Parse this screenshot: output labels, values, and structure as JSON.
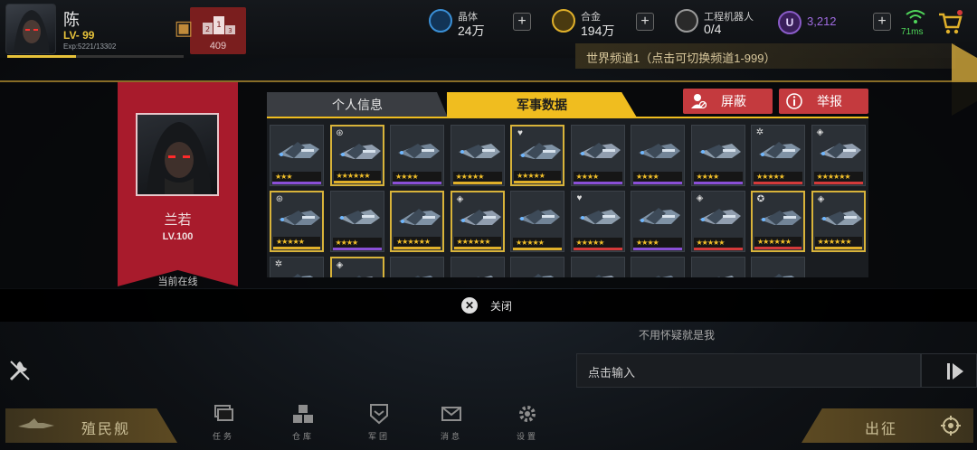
{
  "player": {
    "name": "陈",
    "level": "LV- 99",
    "exp": "Exp:5221/13302",
    "exp_ratio": 0.39,
    "rank_value": "409"
  },
  "resources": [
    {
      "label": "晶体",
      "value": "24万",
      "icon": "crystal-icon",
      "color": "#3a8fd6"
    },
    {
      "label": "合金",
      "value": "194万",
      "icon": "alloy-icon",
      "color": "#e0b02a"
    },
    {
      "label": "工程机器人",
      "value": "0/4",
      "icon": "robot-icon",
      "color": "#bdbdbd"
    }
  ],
  "premium": {
    "symbol": "U",
    "value": "3,212"
  },
  "network": {
    "ping": "71ms"
  },
  "world_channel": {
    "text": "世界频道1（点击可切换频道1-999）"
  },
  "profile": {
    "name": "兰若",
    "level": "LV.100",
    "status": "当前在线"
  },
  "tabs": [
    {
      "label": "个人信息",
      "active": false
    },
    {
      "label": "军事数据",
      "active": true
    }
  ],
  "actions": {
    "block": "屏蔽",
    "report": "举报"
  },
  "ships": [
    {
      "stars": "★★★",
      "rarity": "purple",
      "gold": false,
      "badge": ""
    },
    {
      "stars": "★★★★★★",
      "rarity": "gold",
      "gold": true,
      "badge": "swirl"
    },
    {
      "stars": "★★★★",
      "rarity": "purple",
      "gold": false,
      "badge": ""
    },
    {
      "stars": "★★★★★",
      "rarity": "gold",
      "gold": false,
      "badge": ""
    },
    {
      "stars": "★★★★★",
      "rarity": "gold",
      "gold": true,
      "badge": "heart"
    },
    {
      "stars": "★★★★",
      "rarity": "purple",
      "gold": false,
      "badge": ""
    },
    {
      "stars": "★★★★",
      "rarity": "purple",
      "gold": false,
      "badge": ""
    },
    {
      "stars": "★★★★",
      "rarity": "purple",
      "gold": false,
      "badge": ""
    },
    {
      "stars": "★★★★★",
      "rarity": "red",
      "gold": false,
      "badge": "gear"
    },
    {
      "stars": "★★★★★★",
      "rarity": "red",
      "gold": false,
      "badge": "drone"
    },
    {
      "stars": "★★★★★",
      "rarity": "gold",
      "gold": true,
      "badge": "swirl"
    },
    {
      "stars": "★★★★",
      "rarity": "purple",
      "gold": false,
      "badge": ""
    },
    {
      "stars": "★★★★★★",
      "rarity": "gold",
      "gold": true,
      "badge": ""
    },
    {
      "stars": "★★★★★★",
      "rarity": "gold",
      "gold": true,
      "badge": "drone"
    },
    {
      "stars": "★★★★★",
      "rarity": "gold",
      "gold": false,
      "badge": ""
    },
    {
      "stars": "★★★★★",
      "rarity": "red",
      "gold": false,
      "badge": "heart"
    },
    {
      "stars": "★★★★",
      "rarity": "purple",
      "gold": false,
      "badge": ""
    },
    {
      "stars": "★★★★★",
      "rarity": "red",
      "gold": false,
      "badge": "drone"
    },
    {
      "stars": "★★★★★★",
      "rarity": "red",
      "gold": true,
      "badge": "star"
    },
    {
      "stars": "★★★★★★",
      "rarity": "gold",
      "gold": true,
      "badge": "drone"
    },
    {
      "stars": "",
      "rarity": "none",
      "gold": false,
      "badge": "gear"
    },
    {
      "stars": "",
      "rarity": "none",
      "gold": true,
      "badge": "drone"
    },
    {
      "stars": "",
      "rarity": "none",
      "gold": false,
      "badge": ""
    },
    {
      "stars": "",
      "rarity": "none",
      "gold": false,
      "badge": ""
    },
    {
      "stars": "",
      "rarity": "none",
      "gold": false,
      "badge": ""
    },
    {
      "stars": "",
      "rarity": "none",
      "gold": false,
      "badge": ""
    },
    {
      "stars": "",
      "rarity": "none",
      "gold": false,
      "badge": ""
    },
    {
      "stars": "",
      "rarity": "none",
      "gold": false,
      "badge": ""
    },
    {
      "stars": "",
      "rarity": "none",
      "gold": false,
      "badge": ""
    }
  ],
  "rarity_colors": {
    "purple": "#8a4fd6",
    "gold": "#e0b02a",
    "red": "#d43a3a",
    "none": "transparent"
  },
  "close": {
    "label": "关闭"
  },
  "chat": {
    "preview": "不用怀疑就是我",
    "input_placeholder": "点击输入"
  },
  "bottom_nav": {
    "colony": "殖民舰",
    "deploy": "出征",
    "items": [
      {
        "label": "任务",
        "icon": "task-icon"
      },
      {
        "label": "仓库",
        "icon": "warehouse-icon"
      },
      {
        "label": "军团",
        "icon": "legion-icon"
      },
      {
        "label": "消息",
        "icon": "mail-icon"
      },
      {
        "label": "设置",
        "icon": "gear-icon"
      }
    ]
  }
}
